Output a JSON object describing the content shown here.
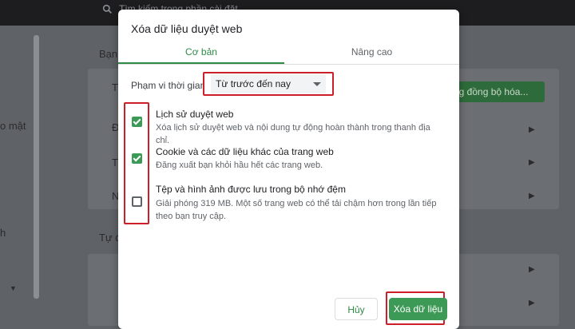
{
  "background": {
    "search_placeholder": "Tìm kiếm trong phần cài đặt",
    "section_label_top": "Bạn",
    "section_label_bottom": "Tự đ",
    "left_fragment_1": "o mật",
    "left_fragment_2": "h",
    "card_letter_1": "T",
    "card_letter_2": "Đ",
    "card_letter_3": "T",
    "card_letter_4": "N",
    "sync_button_label": "ng đồng bộ hóa..."
  },
  "dialog": {
    "title": "Xóa dữ liệu duyệt web",
    "tabs": [
      {
        "label": "Cơ bản",
        "active": true
      },
      {
        "label": "Nâng cao",
        "active": false
      }
    ],
    "time_range": {
      "label": "Phạm vi thời gian",
      "selected": "Từ trước đến nay"
    },
    "options": [
      {
        "title": "Lịch sử duyệt web",
        "description": "Xóa lịch sử duyệt web và nội dung tự động hoàn thành trong thanh địa chỉ.",
        "checked": true
      },
      {
        "title": "Cookie và các dữ liệu khác của trang web",
        "description": "Đăng xuất bạn khỏi hầu hết các trang web.",
        "checked": true
      },
      {
        "title": "Tệp và hình ảnh được lưu trong bộ nhớ đệm",
        "description": "Giải phóng 319 MB. Một số trang web có thể tải chậm hơn trong lần tiếp theo bạn truy cập.",
        "checked": false
      }
    ],
    "cancel_label": "Hủy",
    "clear_label": "Xóa dữ liệu"
  },
  "colors": {
    "accent": "#2e8b45",
    "checkbox_fill": "#3c9a56",
    "highlight": "#cc1f2a"
  }
}
